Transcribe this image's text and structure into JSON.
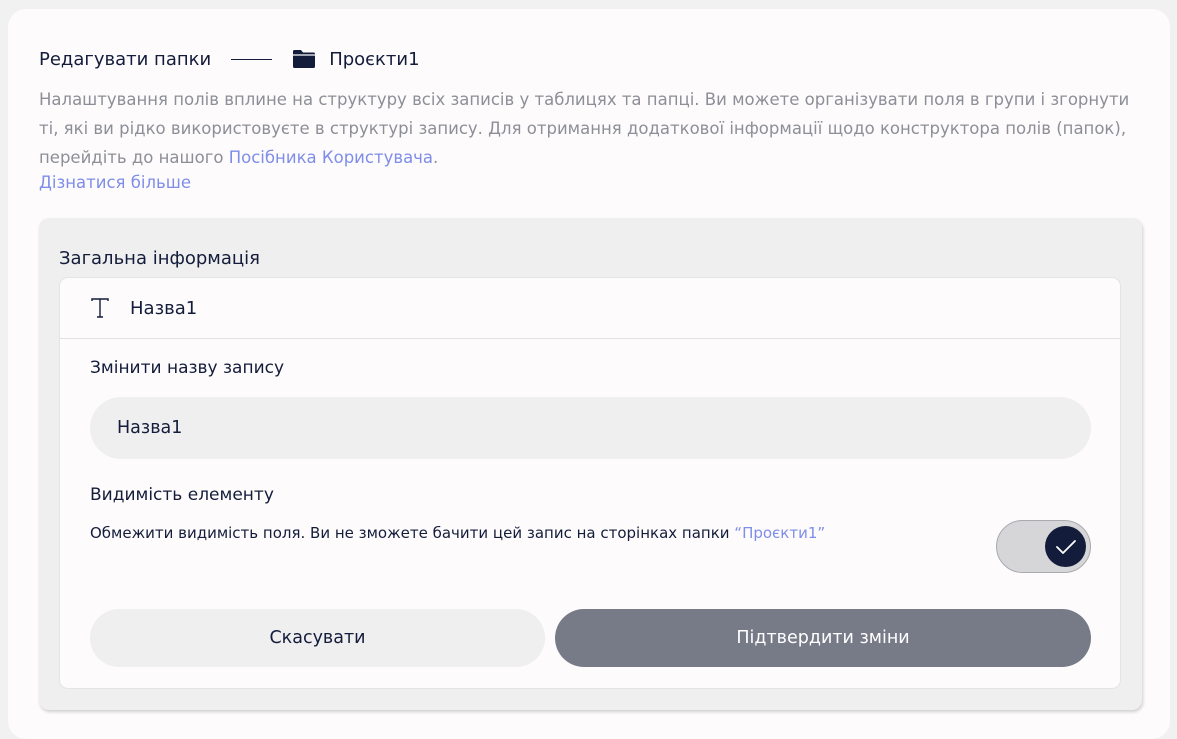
{
  "breadcrumb": {
    "root": "Редагувати папки",
    "current": "Проєкти1"
  },
  "description": {
    "text": "Налаштування полів вплине на структуру всіх записів у таблицях та папці. Ви можете організувати поля в групи і згорнути ті, які ви рідко використовуєте в структурі запису. Для отримання додаткової інформації щодо конструктора полів (папок), перейдіть до нашого ",
    "link": "Посібника Користувача",
    "suffix": "."
  },
  "learn_more": "Дізнатися більше",
  "section": {
    "title": "Загальна інформація",
    "card": {
      "header_title": "Назва1",
      "rename_label": "Змінити назву запису",
      "name_value": "Назва1",
      "visibility_label": "Видимість елементу",
      "visibility_desc": "Обмежити видимість поля. Ви не зможете бачити цей запис на сторінках папки ",
      "visibility_folder": "“Проєкти1”",
      "visibility_enabled": true,
      "cancel_label": "Скасувати",
      "confirm_label": "Підтвердити зміни"
    }
  },
  "colors": {
    "text": "#131c3a",
    "link": "#7e8ee8",
    "muted": "#8d8f97",
    "confirm_button": "#777b88"
  },
  "icons": {
    "breadcrumb": "folder-icon",
    "field_type": "text-type-icon",
    "toggle": "check-icon"
  }
}
